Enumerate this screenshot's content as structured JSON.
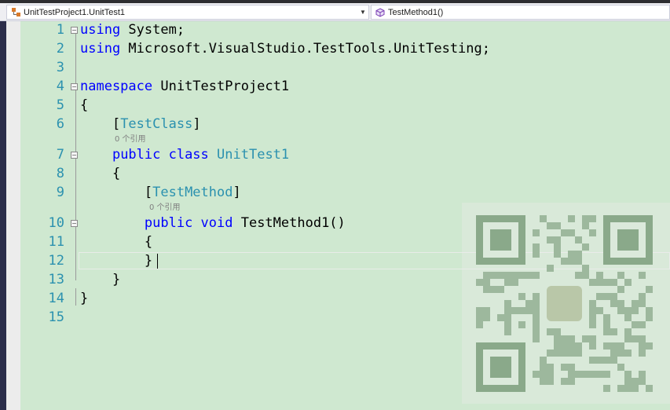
{
  "navbar": {
    "project_dropdown": "UnitTestProject1.UnitTest1",
    "member_dropdown": "TestMethod1()"
  },
  "icons": {
    "project": "class-icon",
    "member": "method-icon",
    "dropdown": "chevron-down-icon"
  },
  "colors": {
    "editor_background": "#cfe8d0",
    "keyword": "#0000ff",
    "type": "#2b91af",
    "line_number": "#2b91af",
    "codelens": "#808080"
  },
  "lines": [
    {
      "num": "1",
      "segments": [
        {
          "t": "using",
          "c": "kw"
        },
        {
          "t": " System;",
          "c": ""
        }
      ]
    },
    {
      "num": "2",
      "segments": [
        {
          "t": "using",
          "c": "kw"
        },
        {
          "t": " Microsoft.VisualStudio.TestTools.UnitTesting;",
          "c": ""
        }
      ]
    },
    {
      "num": "3",
      "segments": []
    },
    {
      "num": "4",
      "segments": [
        {
          "t": "namespace",
          "c": "kw"
        },
        {
          "t": " UnitTestProject1",
          "c": ""
        }
      ]
    },
    {
      "num": "5",
      "segments": [
        {
          "t": "{",
          "c": ""
        }
      ]
    },
    {
      "num": "6",
      "segments": [
        {
          "t": "    [",
          "c": ""
        },
        {
          "t": "TestClass",
          "c": "ty"
        },
        {
          "t": "]",
          "c": ""
        }
      ]
    },
    {
      "num": "7",
      "segments": [
        {
          "t": "    ",
          "c": ""
        },
        {
          "t": "public class",
          "c": "kw"
        },
        {
          "t": " ",
          "c": ""
        },
        {
          "t": "UnitTest1",
          "c": "ty"
        }
      ]
    },
    {
      "num": "8",
      "segments": [
        {
          "t": "    {",
          "c": ""
        }
      ]
    },
    {
      "num": "9",
      "segments": [
        {
          "t": "        [",
          "c": ""
        },
        {
          "t": "TestMethod",
          "c": "ty"
        },
        {
          "t": "]",
          "c": ""
        }
      ]
    },
    {
      "num": "10",
      "segments": [
        {
          "t": "        ",
          "c": ""
        },
        {
          "t": "public void",
          "c": "kw"
        },
        {
          "t": " TestMethod1()",
          "c": ""
        }
      ]
    },
    {
      "num": "11",
      "segments": [
        {
          "t": "        {",
          "c": ""
        }
      ]
    },
    {
      "num": "12",
      "segments": [
        {
          "t": "        }",
          "c": ""
        }
      ]
    },
    {
      "num": "13",
      "segments": [
        {
          "t": "    }",
          "c": ""
        }
      ]
    },
    {
      "num": "14",
      "segments": [
        {
          "t": "}",
          "c": ""
        }
      ]
    },
    {
      "num": "15",
      "segments": []
    }
  ],
  "codelens": {
    "class_refs": "0 个引用",
    "method_refs": "0 个引用"
  }
}
